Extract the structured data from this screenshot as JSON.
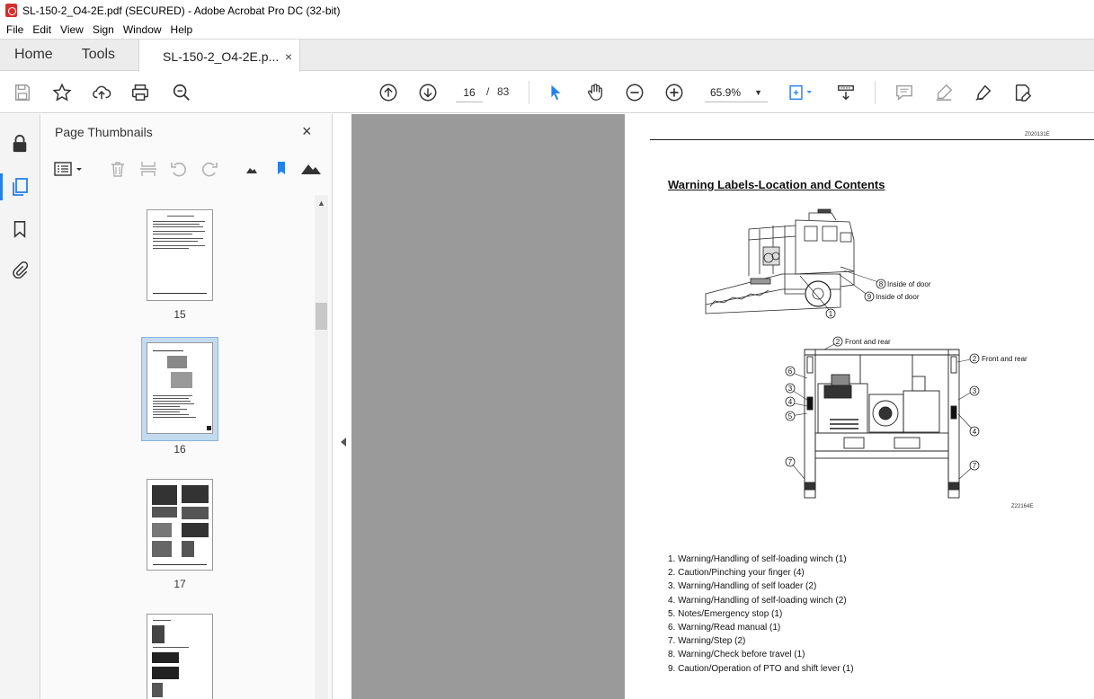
{
  "window": {
    "title": "SL-150-2_O4-2E.pdf (SECURED) - Adobe Acrobat Pro DC (32-bit)"
  },
  "menu": [
    "File",
    "Edit",
    "View",
    "Sign",
    "Window",
    "Help"
  ],
  "tabs": {
    "home": "Home",
    "tools": "Tools",
    "document": "SL-150-2_O4-2E.p...",
    "close": "×"
  },
  "toolbar": {
    "current_page": "16",
    "page_separator": "/",
    "total_pages": "83",
    "zoom": "65.9%"
  },
  "thumbnails_panel": {
    "title": "Page Thumbnails",
    "close": "×",
    "pages": [
      {
        "number": "15",
        "selected": false
      },
      {
        "number": "16",
        "selected": true
      },
      {
        "number": "17",
        "selected": false
      },
      {
        "number": "",
        "selected": false
      }
    ]
  },
  "page": {
    "header_code": "Z020131E",
    "heading": "Warning Labels-Location and Contents",
    "figure_code": "Z22164E",
    "callouts": {
      "inside_door_8": "Inside of door",
      "inside_door_9": "Inside of door",
      "front_rear_left": "Front and rear",
      "front_rear_right": "Front and rear"
    },
    "callout_numbers": [
      "1",
      "2",
      "3",
      "4",
      "5",
      "6",
      "7",
      "8",
      "9"
    ],
    "labels": [
      "1. Warning/Handling of self-loading winch (1)",
      "2. Caution/Pinching your finger (4)",
      "3. Warning/Handling of self loader (2)",
      "4. Warning/Handling of self-loading winch (2)",
      "5. Notes/Emergency stop (1)",
      "6. Warning/Read manual (1)",
      "7. Warning/Step (2)",
      "8. Warning/Check before travel (1)",
      "9. Caution/Operation of PTO and shift lever (1)"
    ]
  },
  "colors": {
    "accent": "#2680eb",
    "acrobat_red": "#d3302f",
    "doc_background": "#9a9a9a",
    "selected_thumb": "#c3dbf1"
  }
}
